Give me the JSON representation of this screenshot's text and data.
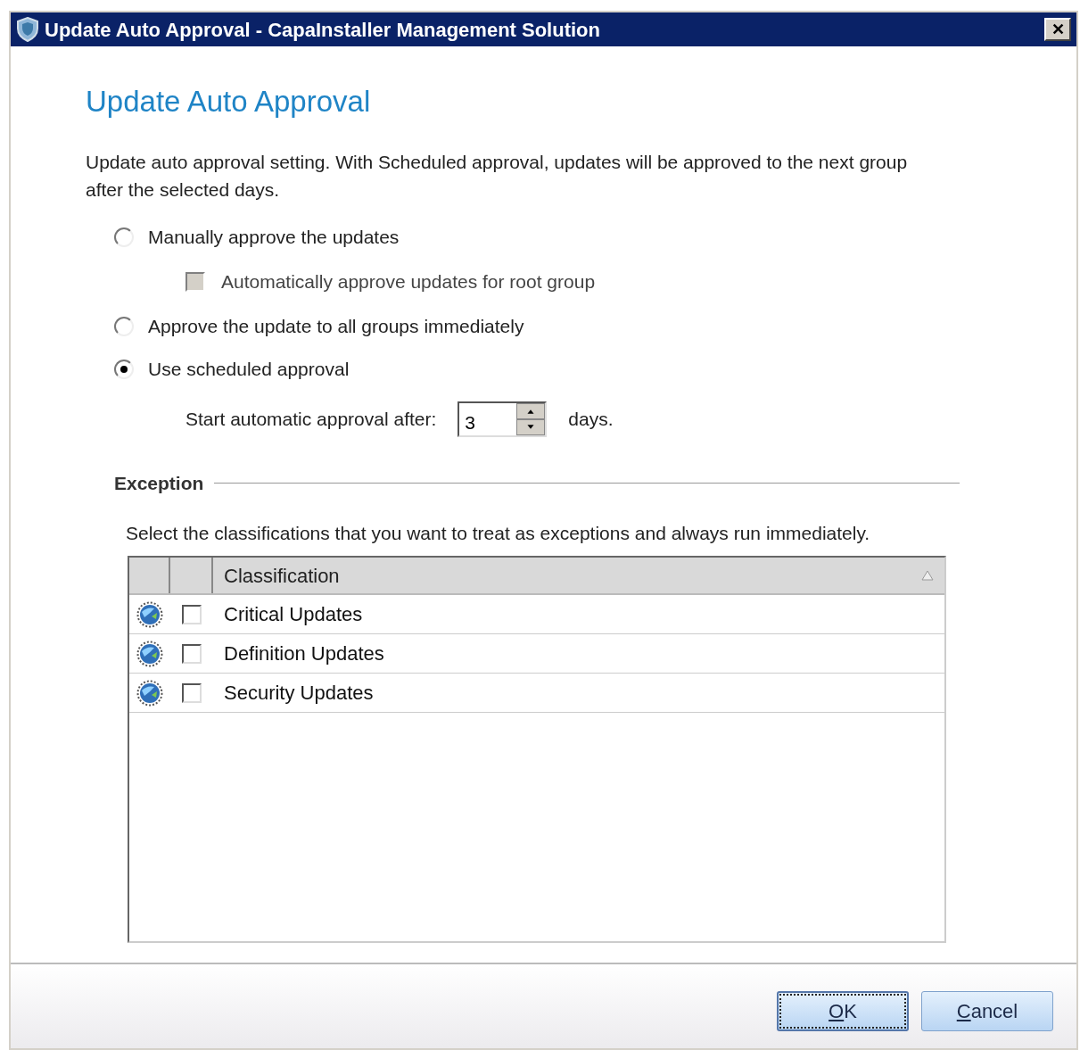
{
  "window": {
    "title": "Update Auto Approval - CapaInstaller Management Solution",
    "close": "✕"
  },
  "heading": "Update Auto Approval",
  "description": "Update auto approval setting. With Scheduled approval, updates will be approved to the next group after the selected days.",
  "options": [
    {
      "kind": "radio",
      "label": "Manually approve the updates",
      "selected": false
    },
    {
      "kind": "checkbox",
      "label": "Automatically approve updates for root group",
      "checked": false,
      "disabled": true
    },
    {
      "kind": "radio",
      "label": "Approve the update to all groups immediately",
      "selected": false
    },
    {
      "kind": "radio",
      "label": "Use scheduled approval",
      "selected": true
    }
  ],
  "delay": {
    "label": "Start automatic approval after:",
    "value": "3",
    "unit": "days."
  },
  "exception": {
    "title": "Exception",
    "hint": "Select the classifications that you want to treat as exceptions and always run immediately.",
    "table": {
      "columns": [
        "Classification"
      ],
      "sort_ascending": true,
      "rows": [
        {
          "name": "Critical Updates",
          "checked": false
        },
        {
          "name": "Definition Updates",
          "checked": false
        },
        {
          "name": "Security Updates",
          "checked": false
        }
      ]
    }
  },
  "buttons": [
    {
      "label": "OK",
      "default": true,
      "access_key_underlined": true
    },
    {
      "label": "Cancel",
      "default": false,
      "access_key_underlined": true
    }
  ]
}
